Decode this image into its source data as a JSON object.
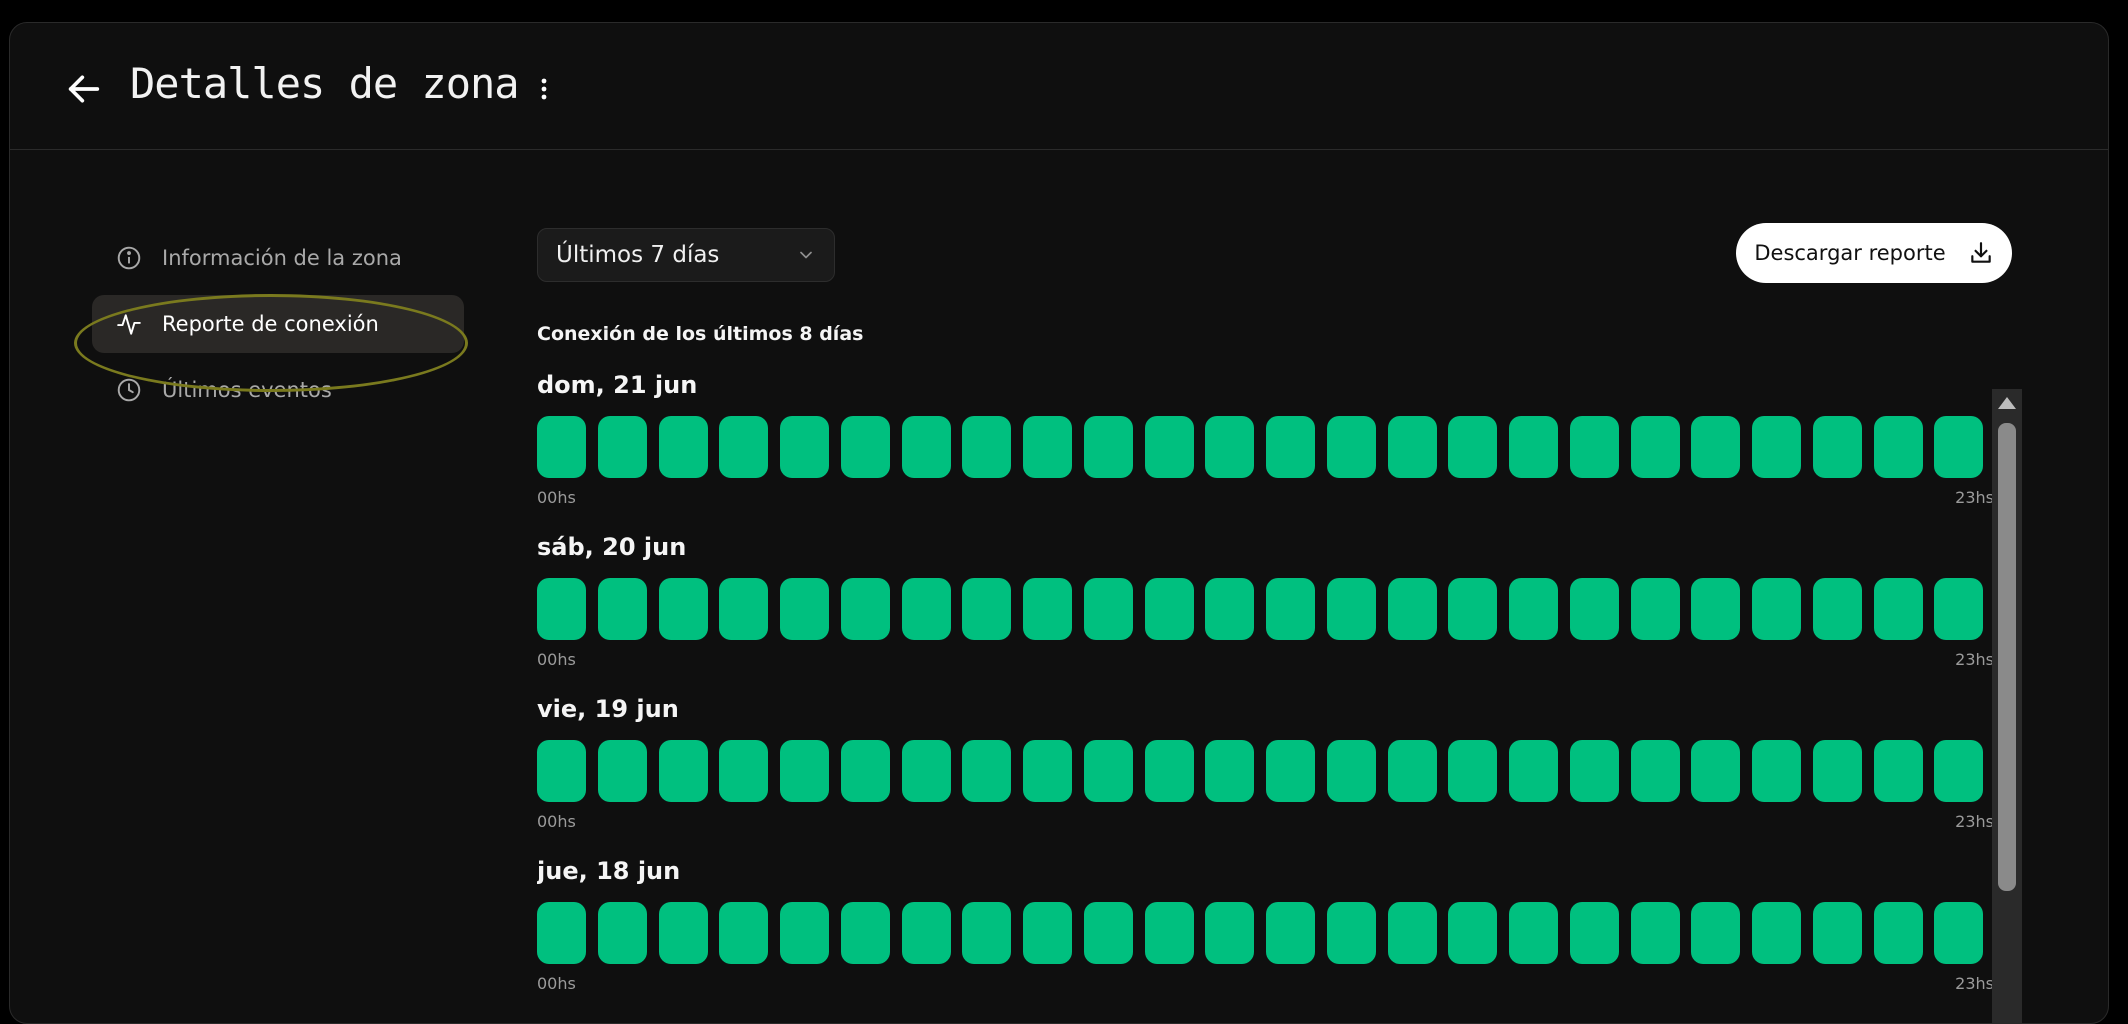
{
  "header": {
    "title": "Detalles de zona"
  },
  "sidebar": {
    "items": [
      {
        "label": "Información de la zona",
        "icon": "info-icon",
        "active": false
      },
      {
        "label": "Reporte de conexión",
        "icon": "activity-icon",
        "active": true
      },
      {
        "label": "Últimos eventos",
        "icon": "clock-icon",
        "active": false
      }
    ]
  },
  "controls": {
    "range_selected": "Últimos 7 días",
    "download_label": "Descargar reporte"
  },
  "report": {
    "section_title": "Conexión de los últimos 8 días",
    "axis_start": "00hs",
    "axis_end": "23hs",
    "status_color": "#00c07f",
    "days": [
      {
        "label": "dom, 21 jun",
        "connected_hours": 24
      },
      {
        "label": "sáb, 20 jun",
        "connected_hours": 24
      },
      {
        "label": "vie, 19 jun",
        "connected_hours": 24
      },
      {
        "label": "jue, 18 jun",
        "connected_hours": 24
      }
    ]
  }
}
